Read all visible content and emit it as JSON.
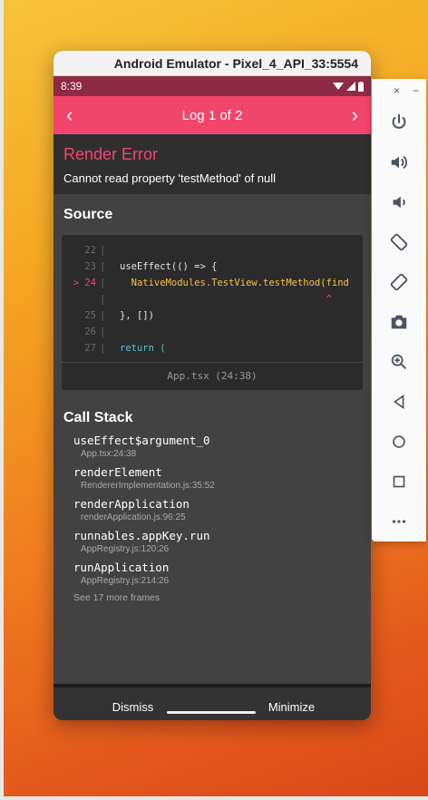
{
  "window": {
    "title": "Android Emulator - Pixel_4_API_33:5554"
  },
  "status_bar": {
    "time": "8:39"
  },
  "log_nav": {
    "title": "Log 1 of 2",
    "prev": "‹",
    "next": "›"
  },
  "error": {
    "title": "Render Error",
    "message": "Cannot read property 'testMethod' of null"
  },
  "source": {
    "heading": "Source",
    "lines": [
      {
        "num": "22",
        "text": ""
      },
      {
        "num": "23",
        "text": "useEffect(() => {"
      },
      {
        "num": "> 24",
        "text": "  NativeModules.TestView.testMethod(find"
      },
      {
        "num": "",
        "text": "                                    ^"
      },
      {
        "num": "25",
        "text": "}, [])"
      },
      {
        "num": "26",
        "text": ""
      },
      {
        "num": "27",
        "text": "return ("
      }
    ],
    "file": "App.tsx (24:38)"
  },
  "call_stack": {
    "heading": "Call Stack",
    "frames": [
      {
        "fn": "useEffect$argument_0",
        "loc": "App.tsx:24:38"
      },
      {
        "fn": "renderElement",
        "loc": "RendererImplementation.js:35:52"
      },
      {
        "fn": "renderApplication",
        "loc": "renderApplication.js:96:25"
      },
      {
        "fn": "runnables.appKey.run",
        "loc": "AppRegistry.js:120:26"
      },
      {
        "fn": "runApplication",
        "loc": "AppRegistry.js:214:26"
      }
    ],
    "more": "See 17 more frames"
  },
  "actions": {
    "dismiss": "Dismiss",
    "minimize": "Minimize"
  },
  "toolbar": {
    "close": "×",
    "minimize": "−",
    "buttons": [
      "power-icon",
      "volume-up-icon",
      "volume-down-icon",
      "rotate-left-icon",
      "rotate-right-icon",
      "camera-icon",
      "zoom-icon",
      "back-icon",
      "home-icon",
      "overview-icon",
      "more-icon"
    ]
  },
  "colors": {
    "accent": "#f2456c",
    "status_bar": "#8e2a43"
  }
}
